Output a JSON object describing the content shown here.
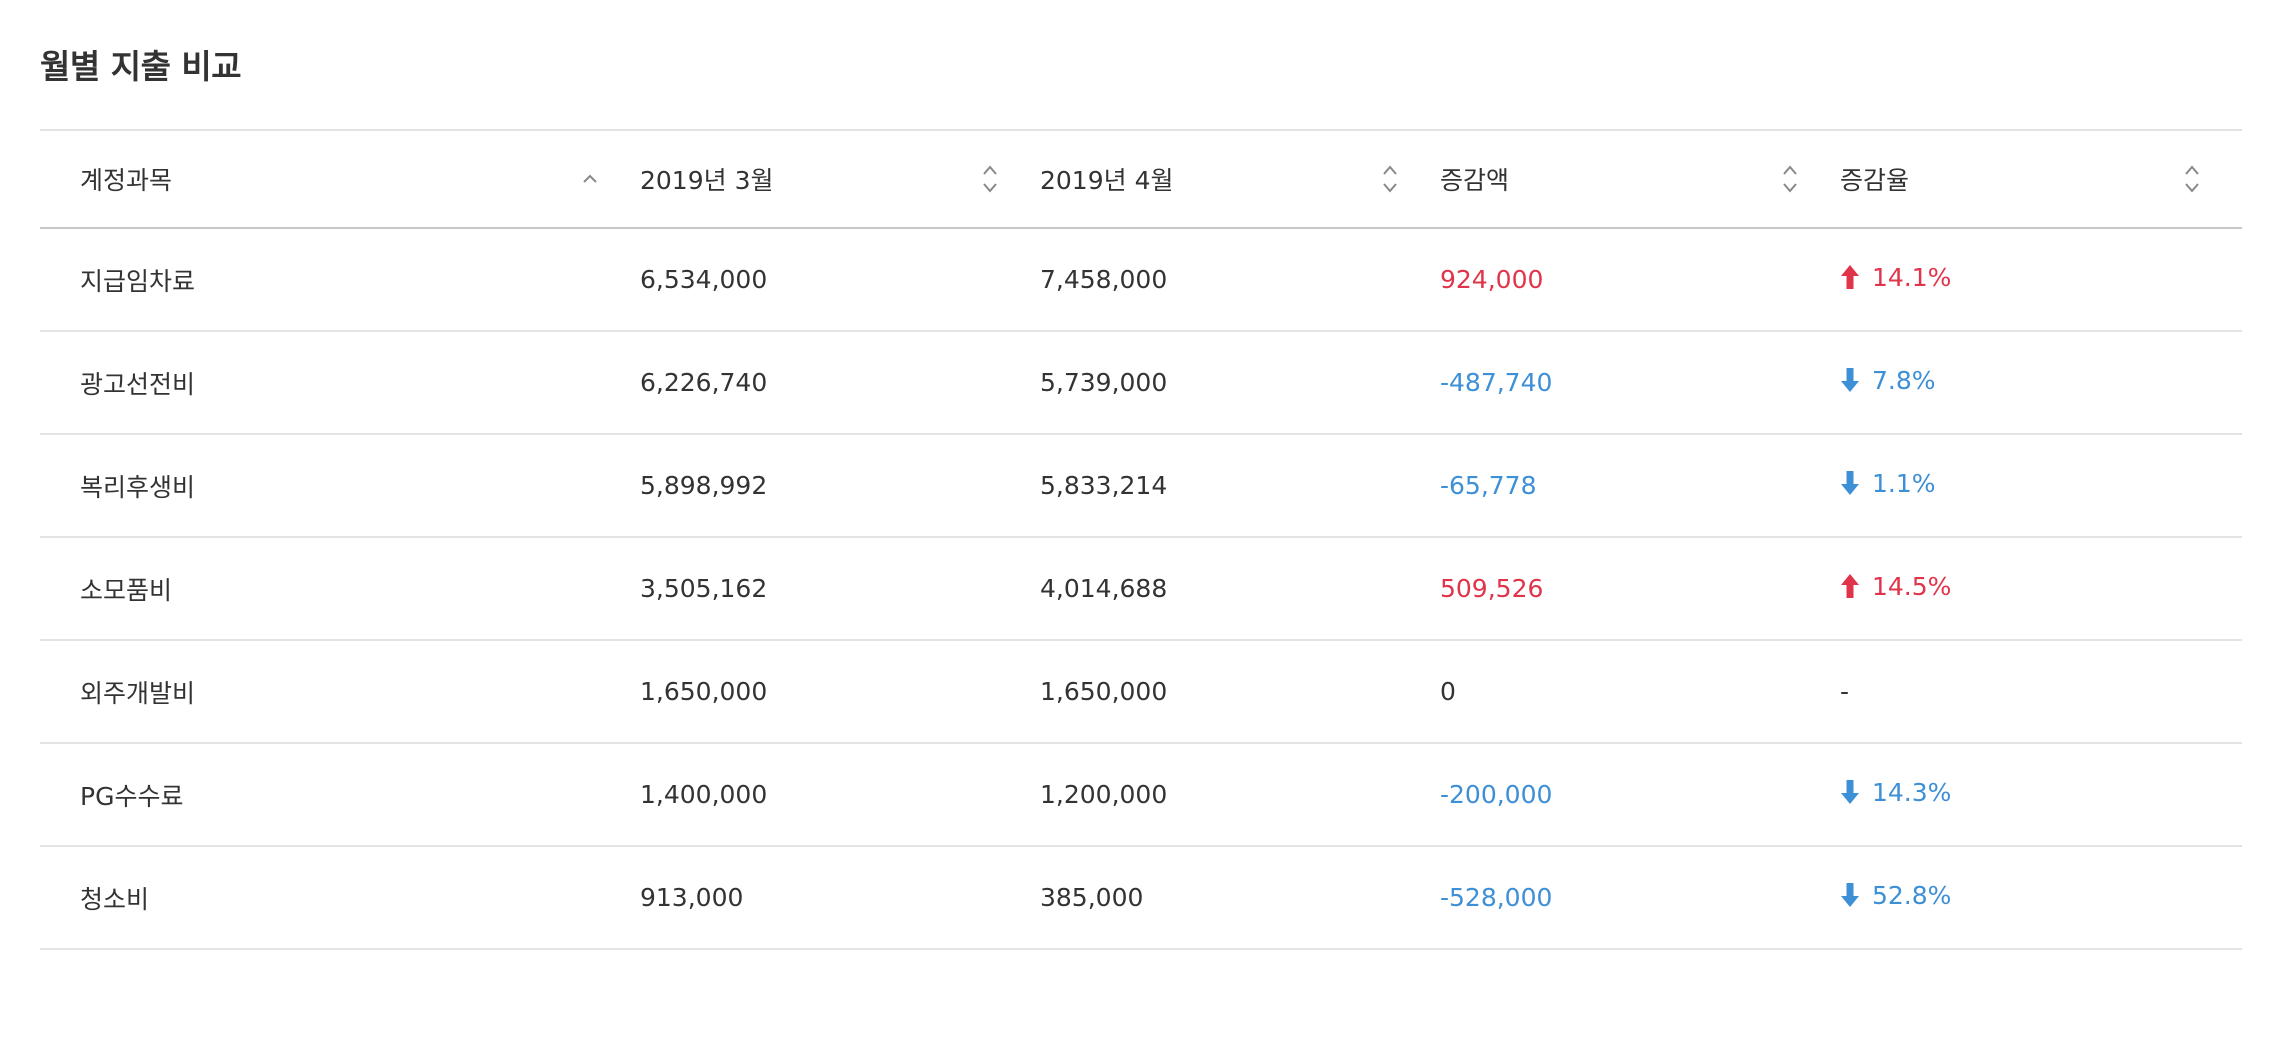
{
  "page": {
    "title": "월별 지출 비교"
  },
  "colors": {
    "increase": "#e0344a",
    "decrease": "#3d8fd6",
    "text": "#333333"
  },
  "table": {
    "columns": [
      {
        "label": "계정과목",
        "sort_icon": "chevron-up-icon"
      },
      {
        "label": "2019년 3월",
        "sort_icon": "sort-icon"
      },
      {
        "label": "2019년 4월",
        "sort_icon": "sort-icon"
      },
      {
        "label": "증감액",
        "sort_icon": "sort-icon"
      },
      {
        "label": "증감율",
        "sort_icon": "sort-icon"
      }
    ],
    "rows": [
      {
        "account": "지급임차료",
        "march": "6,534,000",
        "april": "7,458,000",
        "change": "924,000",
        "rate": "14.1%",
        "direction": "up"
      },
      {
        "account": "광고선전비",
        "march": "6,226,740",
        "april": "5,739,000",
        "change": "-487,740",
        "rate": "7.8%",
        "direction": "down"
      },
      {
        "account": "복리후생비",
        "march": "5,898,992",
        "april": "5,833,214",
        "change": "-65,778",
        "rate": "1.1%",
        "direction": "down"
      },
      {
        "account": "소모품비",
        "march": "3,505,162",
        "april": "4,014,688",
        "change": "509,526",
        "rate": "14.5%",
        "direction": "up"
      },
      {
        "account": "외주개발비",
        "march": "1,650,000",
        "april": "1,650,000",
        "change": "0",
        "rate": "-",
        "direction": "none"
      },
      {
        "account": "PG수수료",
        "march": "1,400,000",
        "april": "1,200,000",
        "change": "-200,000",
        "rate": "14.3%",
        "direction": "down"
      },
      {
        "account": "청소비",
        "march": "913,000",
        "april": "385,000",
        "change": "-528,000",
        "rate": "52.8%",
        "direction": "down"
      }
    ]
  }
}
